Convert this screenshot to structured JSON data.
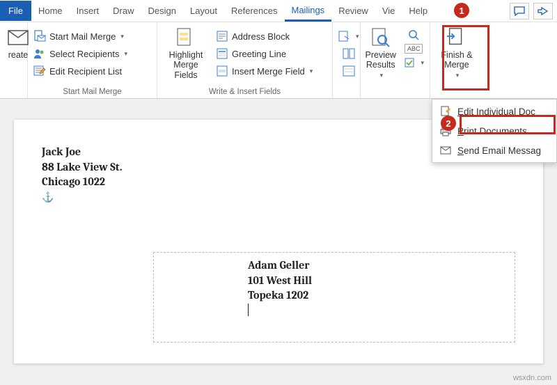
{
  "tabs": {
    "file": "File",
    "home": "Home",
    "insert": "Insert",
    "draw": "Draw",
    "design": "Design",
    "layout": "Layout",
    "references": "References",
    "mailings": "Mailings",
    "review": "Review",
    "view": "Vie",
    "help": "Help"
  },
  "ribbon": {
    "create_group": {
      "create": "reate"
    },
    "start_group": {
      "label": "Start Mail Merge",
      "start_mm": "Start Mail Merge",
      "select_recip": "Select Recipients",
      "edit_recip": "Edit Recipient List"
    },
    "write_group": {
      "label": "Write & Insert Fields",
      "highlight": "Highlight\nMerge Fields",
      "address_block": "Address Block",
      "greeting_line": "Greeting Line",
      "insert_merge": "Insert Merge Field"
    },
    "preview_group": {
      "preview": "Preview\nResults",
      "check": "ABC"
    },
    "finish_group": {
      "finish": "Finish &\nMerge"
    }
  },
  "dropdown": {
    "edit_docs": "Edit Individual Doc",
    "print_docs": "Print Documents.",
    "send_email": "Send Email Messag"
  },
  "document": {
    "ret_name": "Jack Joe",
    "ret_street": "88 Lake View St.",
    "ret_city": "Chicago 1022",
    "recip_name": "Adam Geller",
    "recip_street": "101 West Hill",
    "recip_city": "Topeka 1202"
  },
  "callouts": {
    "one": "1",
    "two": "2"
  },
  "watermark": "wsxdn.com"
}
